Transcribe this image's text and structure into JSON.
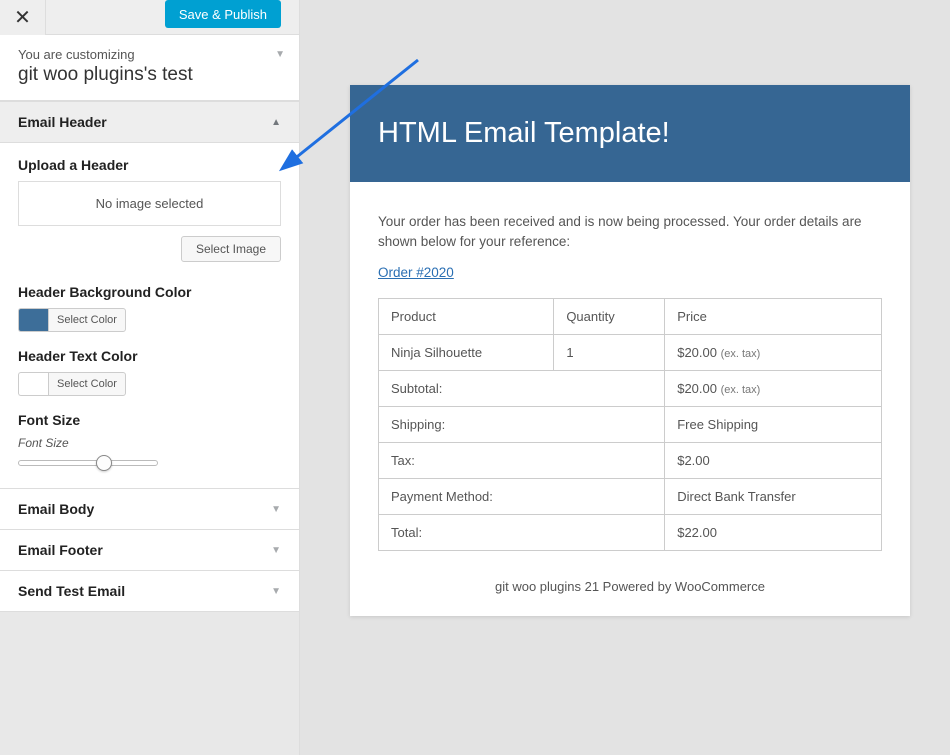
{
  "topbar": {
    "save_publish": "Save & Publish"
  },
  "context": {
    "line1": "You are customizing",
    "line2": "git woo plugins's test"
  },
  "sections": {
    "email_header_title": "Email Header",
    "upload_label": "Upload a Header",
    "no_image": "No image selected",
    "select_image": "Select Image",
    "bg_color_label": "Header Background Color",
    "bg_color_value": "#3d6e99",
    "select_color": "Select Color",
    "text_color_label": "Header Text Color",
    "text_color_value": "#ffffff",
    "font_size_label": "Font Size",
    "font_size_sub": "Font Size"
  },
  "accordion": {
    "email_body": "Email Body",
    "email_footer": "Email Footer",
    "send_test": "Send Test Email"
  },
  "email": {
    "title": "HTML Email Template!",
    "intro": "Your order has been received and is now being processed. Your order details are shown below for your reference:",
    "order_link": "Order #2020",
    "columns": {
      "product": "Product",
      "qty": "Quantity",
      "price": "Price"
    },
    "row1": {
      "product": "Ninja Silhouette",
      "qty": "1",
      "price": "$20.00",
      "suffix": "(ex. tax)"
    },
    "subtotal_label": "Subtotal:",
    "subtotal_price": "$20.00",
    "subtotal_suffix": "(ex. tax)",
    "shipping_label": "Shipping:",
    "shipping_val": "Free Shipping",
    "tax_label": "Tax:",
    "tax_val": "$2.00",
    "payment_label": "Payment Method:",
    "payment_val": "Direct Bank Transfer",
    "total_label": "Total:",
    "total_val": "$22.00",
    "footer": "git woo plugins 21 Powered by WooCommerce"
  }
}
